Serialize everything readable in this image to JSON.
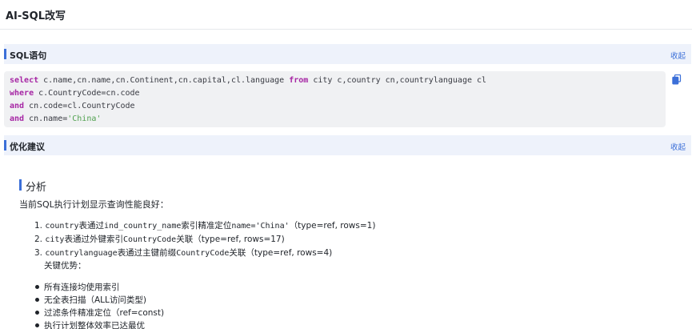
{
  "app": {
    "title": "AI-SQL改写"
  },
  "sql_section": {
    "title": "SQL语句",
    "collapse_label": "收起"
  },
  "sql": {
    "line1": {
      "kw1": "select",
      "t1": " c.name,cn.name,cn.Continent,cn.capital,cl.language ",
      "kw2": "from",
      "t2": " city c,country cn,countrylanguage cl"
    },
    "line2": {
      "kw": "where",
      "t": " c.CountryCode=cn.code"
    },
    "line3": {
      "kw": "and",
      "t": " cn.code=cl.CountryCode"
    },
    "line4": {
      "kw": "and",
      "t": " cn.name=",
      "str": "'China'"
    }
  },
  "copy_icon": "copy-icon",
  "suggest_section": {
    "title": "优化建议",
    "collapse_label": "收起"
  },
  "analysis": {
    "heading": "分析",
    "summary": "当前SQL执行计划显示查询性能良好：",
    "items": [
      {
        "num": "1.",
        "mono": "country",
        "t1": "表通过",
        "mono2": "ind_country_name",
        "t2": "索引精准定位",
        "mono3": "name='China'",
        "t3": "（type=ref, rows=1)"
      },
      {
        "num": "2.",
        "mono": "city",
        "t1": "表通过外键索引",
        "mono2": "CountryCode",
        "t2": "关联（type=ref, rows=17)"
      },
      {
        "num": "3.",
        "mono": "countrylanguage",
        "t1": "表通过主键前缀",
        "mono2": "CountryCode",
        "t2": "关联（type=ref, rows=4)"
      }
    ],
    "advantages_label": "关键优势：",
    "advantages": [
      "所有连接均使用索引",
      "无全表扫描（ALL访问类型)",
      "过滤条件精准定位（ref=const)",
      "执行计划整体效率已达最优"
    ]
  },
  "colors": {
    "accent": "#3b6fd8",
    "section_bg": "#eef2fb",
    "code_bg": "#f0f1f3",
    "keyword": "#a626a4",
    "string": "#50a14f"
  }
}
